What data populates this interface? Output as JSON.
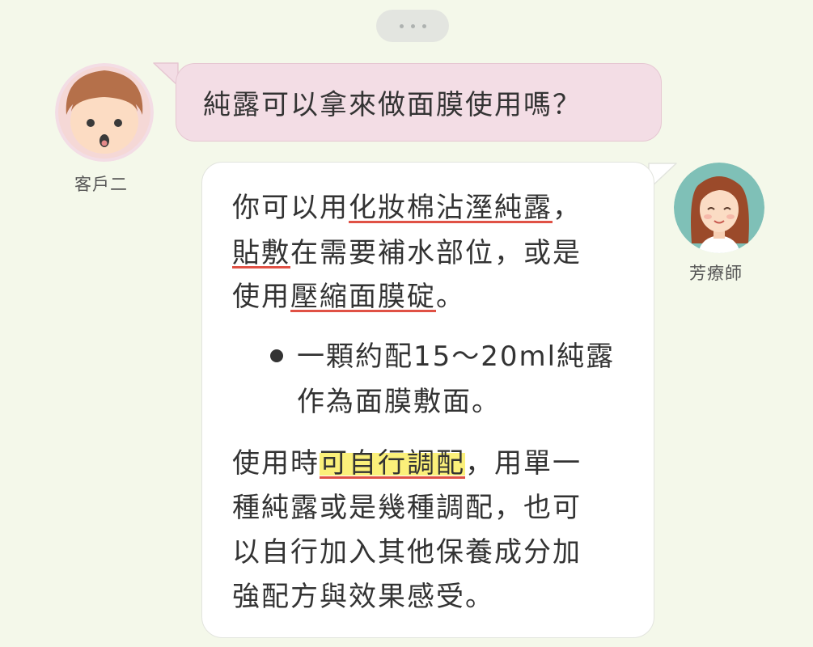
{
  "colors": {
    "background": "#f4f8ea",
    "question_bubble": "#f3dde5",
    "answer_bubble": "#ffffff",
    "underline": "#e05145",
    "highlight": "#fbf07a"
  },
  "more_indicator": {
    "icon": "more-dots-icon"
  },
  "customer": {
    "avatar_icon": "customer-avatar-icon",
    "name": "客戶二",
    "question": "純露可以拿來做面膜使用嗎？"
  },
  "therapist": {
    "avatar_icon": "therapist-avatar-icon",
    "name": "芳療師",
    "answer": {
      "p1": {
        "l1_a": "你可以用",
        "l1_b": "化妝棉沾溼純露",
        "l1_c": "，",
        "l2_a": "貼敷",
        "l2_b": "在需要補水部位，或是",
        "l3_a": "使用",
        "l3_b": "壓縮面膜碇",
        "l3_c": "。"
      },
      "bullet": {
        "l1": "一顆約配15～20ml純露",
        "l2": "作為面膜敷面。"
      },
      "p2": {
        "l1_a": "使用時",
        "l1_b": "可自行調配",
        "l1_c": "，用單一",
        "l2": "種純露或是幾種調配，也可",
        "l3": "以自行加入其他保養成分加",
        "l4": "強配方與效果感受。"
      }
    }
  }
}
